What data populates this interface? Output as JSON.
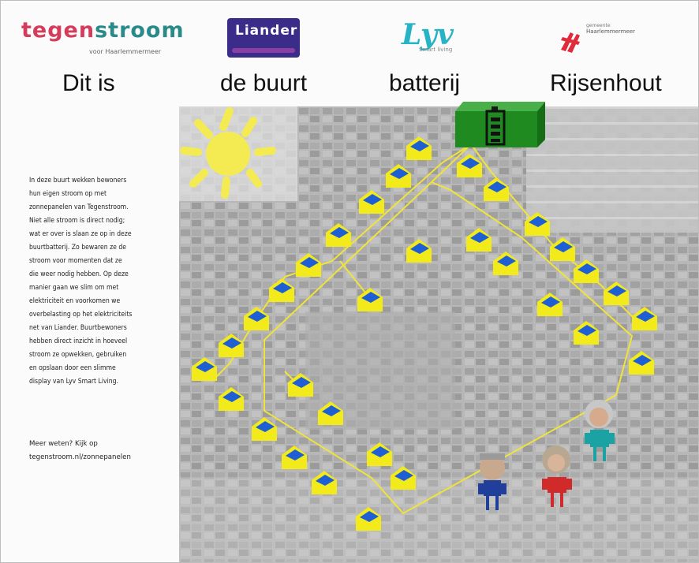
{
  "logos": {
    "tegenstroom": "tegenstroom",
    "tegenstroom_sub": "voor Haarlemmermeer",
    "liander": "Liander",
    "lyv": "Lyv",
    "lyv_sub": "Smart living",
    "gemeente_small": "gemeente",
    "gemeente_big": "Haarlemmermeer"
  },
  "headings": [
    "Dit is",
    "de buurt",
    "batterij",
    "Rijsenhout"
  ],
  "body_text": "In deze buurt wekken bewoners\nhun eigen stroom op met\nzonnepanelen van Tegenstroom.\nNiet alle stroom is direct nodig;\nwat er over is slaan ze op in deze\nbuurtbatterij. Zo bewaren ze de\nstroom voor momenten dat ze\ndie weer nodig hebben. Op deze\nmanier gaan we slim om met\nelektriciteit en voorkomen we\noverbelasting op het elektriciteits\nnet van Liander. Buurtbewoners\nhebben direct inzicht in hoeveel\nstroom ze opwekken, gebruiken\nen opslaan door een slimme\ndisplay van Lyv Smart Living.",
  "more_text": "Meer weten? Kijk op\ntegenstroom.nl/zonnepanelen",
  "colors": {
    "house": "#f2ea1a",
    "panel": "#1f5fd6",
    "battery": "#1f8a1f",
    "sun": "#f4eb52",
    "cable": "#f0e43a"
  },
  "icons": [
    "sun-icon",
    "battery-icon",
    "house-icon",
    "solar-panel-icon",
    "plug-person-icon"
  ]
}
